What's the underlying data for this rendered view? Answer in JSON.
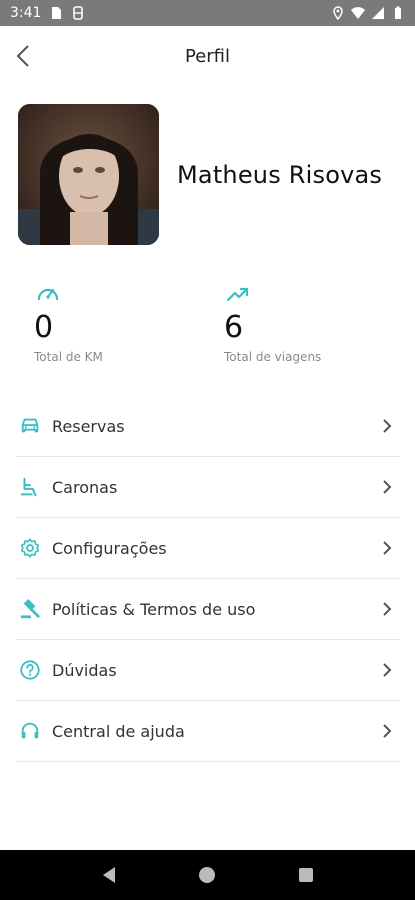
{
  "status_bar": {
    "time": "3:41"
  },
  "header": {
    "title": "Perfil"
  },
  "profile": {
    "name": "Matheus Risovas"
  },
  "stats": [
    {
      "value": "0",
      "label": "Total de KM"
    },
    {
      "value": "6",
      "label": "Total de viagens"
    }
  ],
  "menu": {
    "items": [
      {
        "label": "Reservas",
        "icon": "car-icon"
      },
      {
        "label": "Caronas",
        "icon": "seat-icon"
      },
      {
        "label": "Configurações",
        "icon": "gear-icon"
      },
      {
        "label": "Políticas & Termos de uso",
        "icon": "gavel-icon"
      },
      {
        "label": "Dúvidas",
        "icon": "help-circle-icon"
      },
      {
        "label": "Central de ajuda",
        "icon": "headset-icon"
      }
    ]
  },
  "colors": {
    "accent": "#3bbfc4",
    "status_bar": "#7a7a7a",
    "nav_bar": "#000000"
  }
}
